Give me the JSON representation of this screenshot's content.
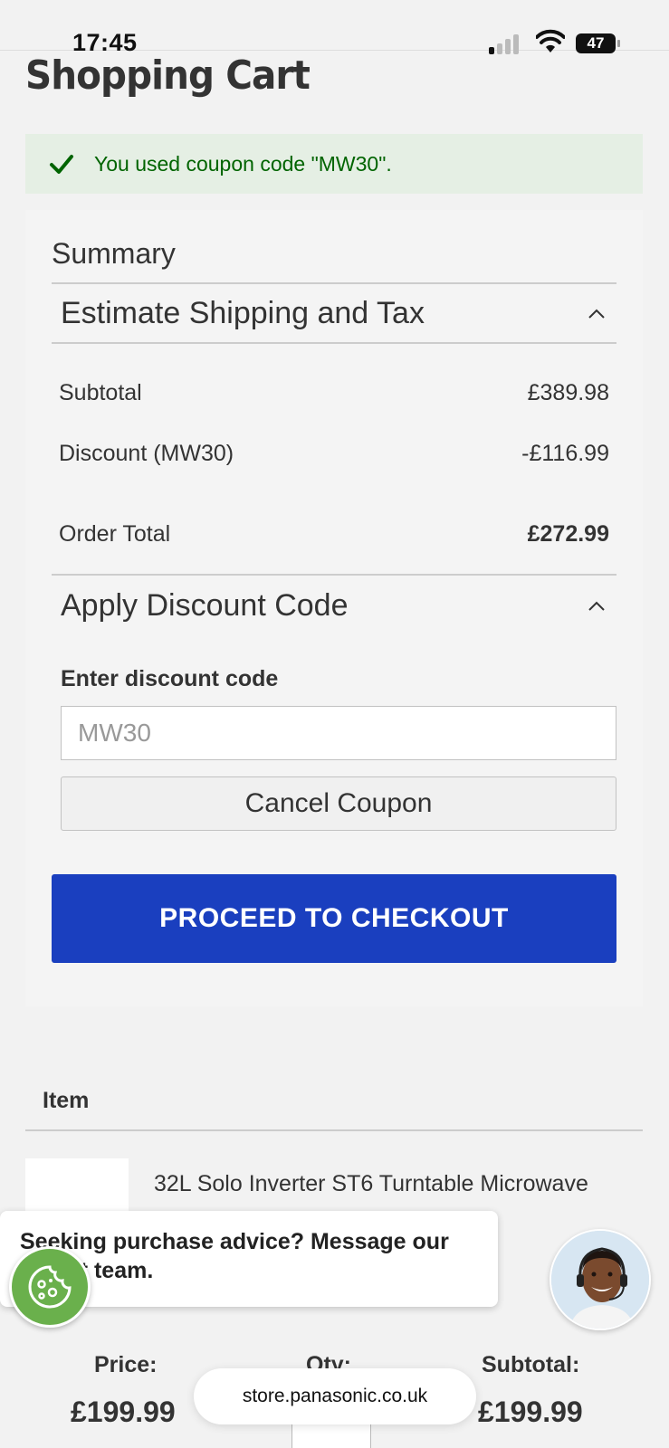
{
  "status_bar": {
    "time": "17:45",
    "battery": "47",
    "icons": [
      "cellular-signal-icon",
      "wifi-icon",
      "battery-icon"
    ]
  },
  "page": {
    "title": "Shopping Cart"
  },
  "coupon_message": {
    "text": "You used coupon code \"MW30\".",
    "icon": "checkmark-icon",
    "color": "#006400"
  },
  "summary": {
    "title": "Summary",
    "shipping_section": {
      "label": "Estimate Shipping and Tax",
      "expanded": true
    },
    "rows": [
      {
        "label": "Subtotal",
        "value": "£389.98"
      },
      {
        "label": "Discount (MW30)",
        "value": "-£116.99"
      }
    ],
    "order_total": {
      "label": "Order Total",
      "value": "£272.99"
    },
    "discount_section": {
      "label": "Apply Discount Code",
      "expanded": true
    },
    "discount_field": {
      "label": "Enter discount code",
      "value": "MW30"
    },
    "cancel_label": "Cancel Coupon",
    "checkout_label": "PROCEED TO CHECKOUT",
    "checkout_color": "#1a3fbf"
  },
  "items": {
    "header": "Item",
    "list": [
      {
        "name": "32L Solo Inverter ST6 Turntable Microwave Oven - Silver NN-ST68QSBPQ",
        "price": "£199.99",
        "subtotal": "£199.99"
      }
    ],
    "columns": {
      "price": "Price:",
      "qty": "Qty:",
      "subtotal": "Subtotal:"
    }
  },
  "chat_prompt": {
    "text": "Seeking purchase advice? Message our expert team."
  },
  "browser": {
    "url": "store.panasonic.co.uk"
  }
}
